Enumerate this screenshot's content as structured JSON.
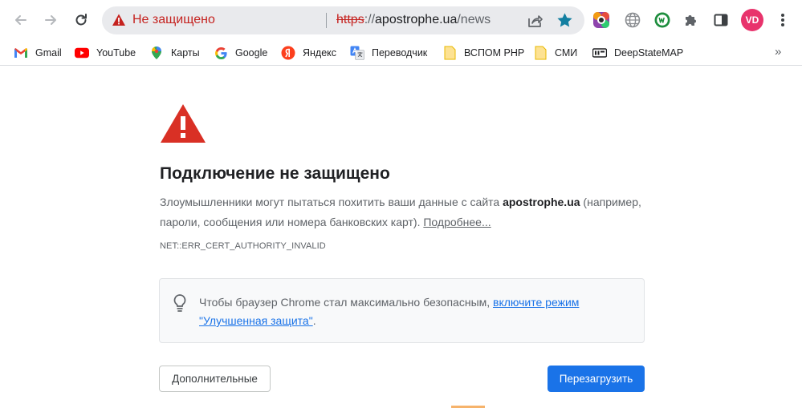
{
  "toolbar": {
    "back_icon": "arrow-left-icon",
    "forward_icon": "arrow-right-icon",
    "reload_icon": "reload-icon",
    "address": {
      "security_status": "Не защищено",
      "url_scheme": "https",
      "url_separator": "://",
      "url_host": "apostrophe.ua",
      "url_path": "/news"
    },
    "profile_initials": "VD",
    "accent_color": "#1a73e8",
    "warning_color": "#c5221f"
  },
  "bookmarks": {
    "items": [
      {
        "label": "Gmail",
        "icon": "gmail-icon"
      },
      {
        "label": "YouTube",
        "icon": "youtube-icon"
      },
      {
        "label": "Карты",
        "icon": "maps-pin-icon"
      },
      {
        "label": "Google",
        "icon": "google-icon"
      },
      {
        "label": "Яндекс",
        "icon": "yandex-icon"
      },
      {
        "label": "Переводчик",
        "icon": "translate-icon"
      },
      {
        "label": "ВСПОМ PHP",
        "icon": "folder-icon"
      },
      {
        "label": "СМИ",
        "icon": "folder-icon"
      },
      {
        "label": "DeepStateMAP",
        "icon": "deepstate-icon"
      }
    ],
    "overflow": "»"
  },
  "interstitial": {
    "heading": "Подключение не защищено",
    "desc_before": "Злоумышленники могут пытаться похитить ваши данные с сайта ",
    "desc_site": "apostrophe.ua",
    "desc_after": " (например, пароли, сообщения или номера банковских карт). ",
    "desc_link": "Подробнее...",
    "error_code": "NET::ERR_CERT_AUTHORITY_INVALID",
    "tip_before": "Чтобы браузер Chrome стал максимально безопасным, ",
    "tip_link": "включите режим \"Улучшенная защита\"",
    "tip_after": ".",
    "advanced_button": "Дополнительные",
    "reload_button": "Перезагрузить"
  }
}
